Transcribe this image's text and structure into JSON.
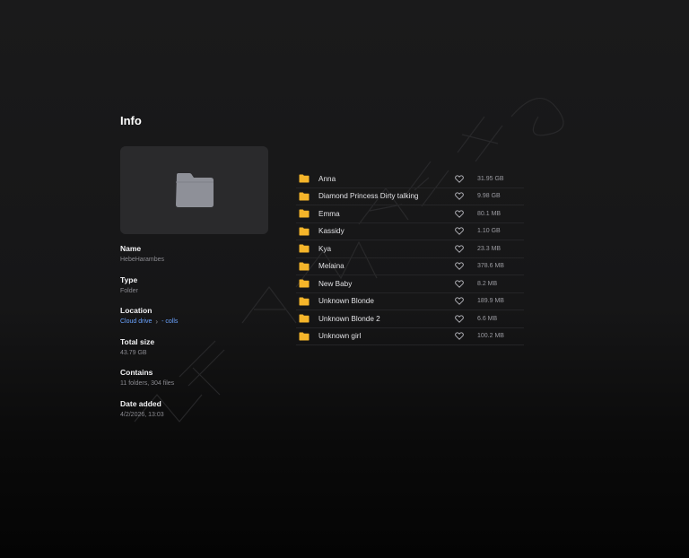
{
  "panel": {
    "title": "Info"
  },
  "preview": {
    "icon": "folder-icon",
    "icon_color": "#8e9098"
  },
  "details": {
    "name_label": "Name",
    "name_value": "HebeHarambes",
    "type_label": "Type",
    "type_value": "Folder",
    "location_label": "Location",
    "location_root": "Cloud drive",
    "location_child": "- colls",
    "total_size_label": "Total size",
    "total_size_value": "43.79 GB",
    "contains_label": "Contains",
    "contains_value": "11 folders, 304 files",
    "date_added_label": "Date added",
    "date_added_value": "4/2/2026, 13:03"
  },
  "items": [
    {
      "name": "Anna",
      "size": "31.95 GB"
    },
    {
      "name": "Diamond Princess Dirty talking",
      "size": "9.98 GB"
    },
    {
      "name": "Emma",
      "size": "80.1 MB"
    },
    {
      "name": "Kassidy",
      "size": "1.10 GB"
    },
    {
      "name": "Kya",
      "size": "23.3 MB"
    },
    {
      "name": "Melaina",
      "size": "378.6 MB"
    },
    {
      "name": "New Baby",
      "size": "8.2 MB"
    },
    {
      "name": "Unknown Blonde",
      "size": "189.9 MB"
    },
    {
      "name": "Unknown Blonde 2",
      "size": "6.6 MB"
    },
    {
      "name": "Unknown girl",
      "size": "100.2 MB"
    }
  ],
  "colors": {
    "folder_accent": "#f5b52a",
    "link": "#6aa3ff"
  }
}
